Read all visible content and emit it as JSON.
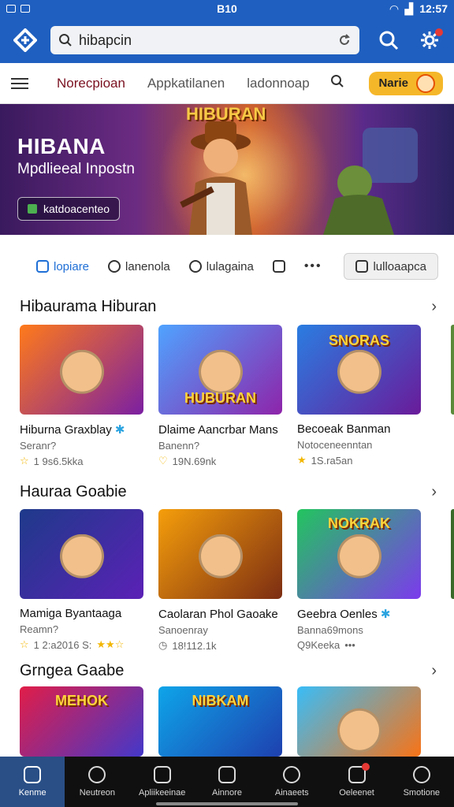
{
  "status": {
    "clock": "B10",
    "time": "12:57"
  },
  "search": {
    "value": "hibapcin"
  },
  "nav": {
    "tabs": [
      "Norecpioan",
      "Appkatilanen",
      "ladonnoap"
    ],
    "user_name": "Narie"
  },
  "banner": {
    "art_title": "HIBURAN",
    "title": "HIBANA",
    "subtitle": "Mpdlieeal Inpostn",
    "cta": "katdoacenteo"
  },
  "filters": [
    {
      "label": "lopiare",
      "active": true
    },
    {
      "label": "lanenola",
      "active": false
    },
    {
      "label": "lulagaina",
      "active": false
    },
    {
      "label": "lulloaapca",
      "active": false
    }
  ],
  "sections": [
    {
      "title": "Hibaurama Hiburan",
      "cards": [
        {
          "title": "Hiburna Graxblay",
          "subtitle": "Seranr?",
          "rating": "1 9s6.5kka",
          "art": "",
          "colors": [
            "#ff7a1a",
            "#7b1fa2"
          ]
        },
        {
          "title": "Dlaime Aancrbar Mans",
          "subtitle": "Banenn?",
          "rating": "19N.69nk",
          "art": "HUBURAN",
          "colors": [
            "#4fa3ff",
            "#8e24aa"
          ]
        },
        {
          "title": "Becoeak Banman",
          "subtitle": "Notoceneenntan",
          "rating": "1S.ra5an",
          "art": "SNORAS",
          "colors": [
            "#2a7de1",
            "#6a1b9a"
          ]
        }
      ]
    },
    {
      "title": "Hauraa Goabie",
      "cards": [
        {
          "title": "Mamiga Byantaaga",
          "subtitle": "Reamn?",
          "rating": "1 2:a2016 S:",
          "art": "",
          "colors": [
            "#1e3a8a",
            "#5b21b6"
          ]
        },
        {
          "title": "Caolaran Phol Gaoake",
          "subtitle": "Sanoenray",
          "rating": "18!112.1k",
          "art": "",
          "colors": [
            "#f59e0b",
            "#7c2d12"
          ]
        },
        {
          "title": "Geebra Oenles",
          "subtitle": "Banna69mons",
          "rating": "Q9Keeka",
          "art": "NOKRAK",
          "colors": [
            "#22c55e",
            "#7c3aed"
          ]
        }
      ]
    },
    {
      "title": "Grngea Gaabe",
      "cards": [
        {
          "title": "",
          "subtitle": "",
          "rating": "",
          "art": "MEHOK",
          "colors": [
            "#e11d48",
            "#4338ca"
          ]
        },
        {
          "title": "",
          "subtitle": "",
          "rating": "",
          "art": "NIBKAM",
          "colors": [
            "#0ea5e9",
            "#1e40af"
          ]
        },
        {
          "title": "",
          "subtitle": "",
          "rating": "",
          "art": "",
          "colors": [
            "#38bdf8",
            "#f97316"
          ]
        }
      ]
    }
  ],
  "bottom_nav": [
    "Kenme",
    "Neutreon",
    "Apliikeeinae",
    "Ainnore",
    "Ainaeets",
    "Oeleenet",
    "Smotione"
  ]
}
